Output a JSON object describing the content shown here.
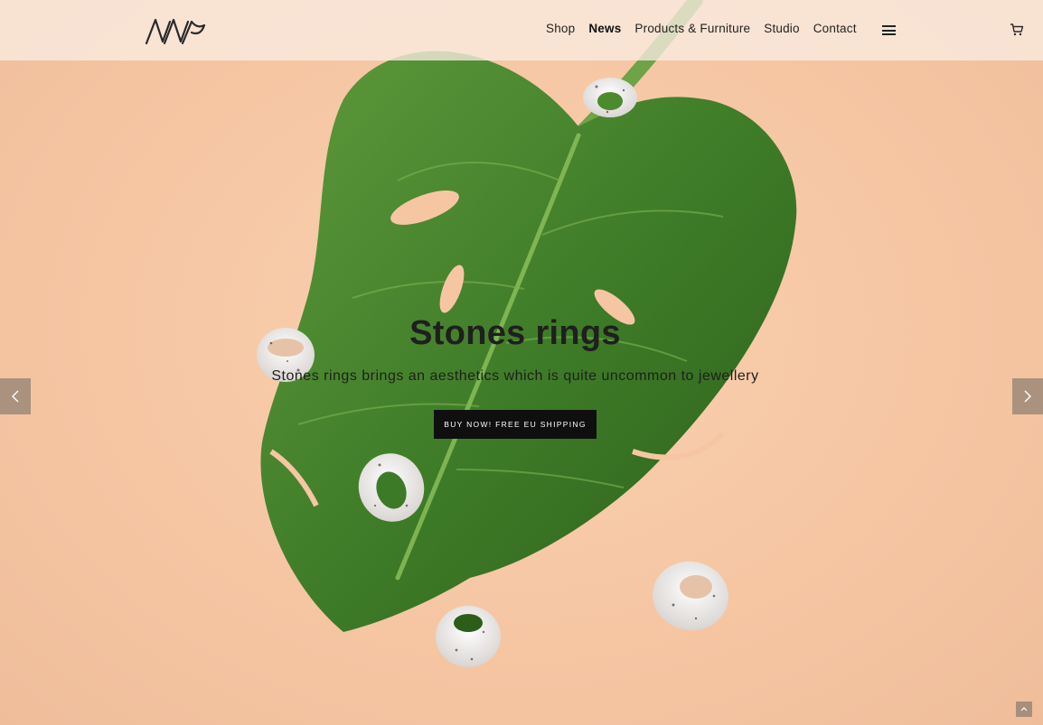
{
  "header": {
    "logo_alt": "AVV logo"
  },
  "nav": {
    "items": [
      {
        "label": "Shop",
        "active": false
      },
      {
        "label": "News",
        "active": true
      },
      {
        "label": "Products & Furniture",
        "active": false
      },
      {
        "label": "Studio",
        "active": false
      },
      {
        "label": "Contact",
        "active": false
      }
    ],
    "menu_icon": "hamburger-icon",
    "cart_icon": "cart-icon"
  },
  "hero": {
    "title": "Stones rings",
    "subtitle": "Stones rings brings an aesthetics which is quite uncommon to jewellery",
    "cta_label": "BUY NOW! FREE EU SHIPPING",
    "prev_icon": "chevron-left-icon",
    "next_icon": "chevron-right-icon"
  },
  "footer": {
    "to_top_icon": "chevron-up-icon"
  },
  "colors": {
    "background": "#f6c6a3",
    "leaf": "#3f7e2a",
    "cta_background": "#0f0f0f",
    "text": "#1f1f1f"
  }
}
